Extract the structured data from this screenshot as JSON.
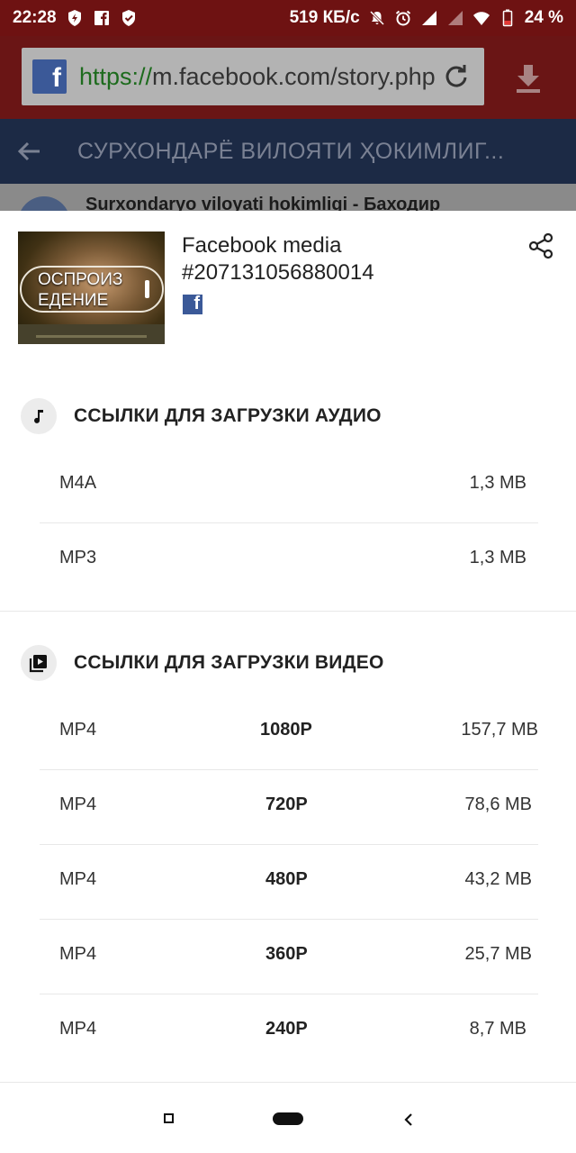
{
  "status_bar": {
    "time": "22:28",
    "network_speed": "519 КБ/с",
    "battery": "24 %",
    "icons": [
      "shield-bolt-icon",
      "facebook-icon",
      "shield-check-icon",
      "mute-icon",
      "alarm-icon",
      "signal-icon",
      "signal-icon",
      "wifi-icon",
      "battery-icon"
    ]
  },
  "browser": {
    "url_scheme": "https://",
    "url_rest": "m.facebook.com/story.php",
    "icons": [
      "facebook-icon",
      "reload-icon",
      "download-icon"
    ]
  },
  "page_header": {
    "title": "СУРХОНДАРЁ ВИЛОЯТИ ҲОКИМЛИГ...",
    "peek_text": "Surxondaryo viloyati hokimligi - Баходир"
  },
  "media": {
    "title": "Facebook media #207131056880014",
    "thumbnail_overlay": "ОСПРОИЗ ЕДЕНИЕ",
    "source_icon": "facebook-icon"
  },
  "audio_section": {
    "title": "ССЫЛКИ ДЛЯ ЗАГРУЗКИ АУДИО",
    "icon": "music-note-icon",
    "items": [
      {
        "format": "M4A",
        "size": "1,3 MB"
      },
      {
        "format": "MP3",
        "size": "1,3 MB"
      }
    ]
  },
  "video_section": {
    "title": "ССЫЛКИ ДЛЯ ЗАГРУЗКИ ВИДЕО",
    "icon": "video-library-icon",
    "items": [
      {
        "format": "MP4",
        "quality": "1080P",
        "size": "157,7 MB"
      },
      {
        "format": "MP4",
        "quality": "720P",
        "size": "78,6 MB"
      },
      {
        "format": "MP4",
        "quality": "480P",
        "size": "43,2 MB"
      },
      {
        "format": "MP4",
        "quality": "360P",
        "size": "25,7 MB"
      },
      {
        "format": "MP4",
        "quality": "240P",
        "size": "8,7 MB"
      }
    ]
  },
  "colors": {
    "status_bar": "#6e1212",
    "browser_bar": "#6a1515",
    "page_header": "#1c2a45",
    "facebook_blue": "#3b5998"
  }
}
